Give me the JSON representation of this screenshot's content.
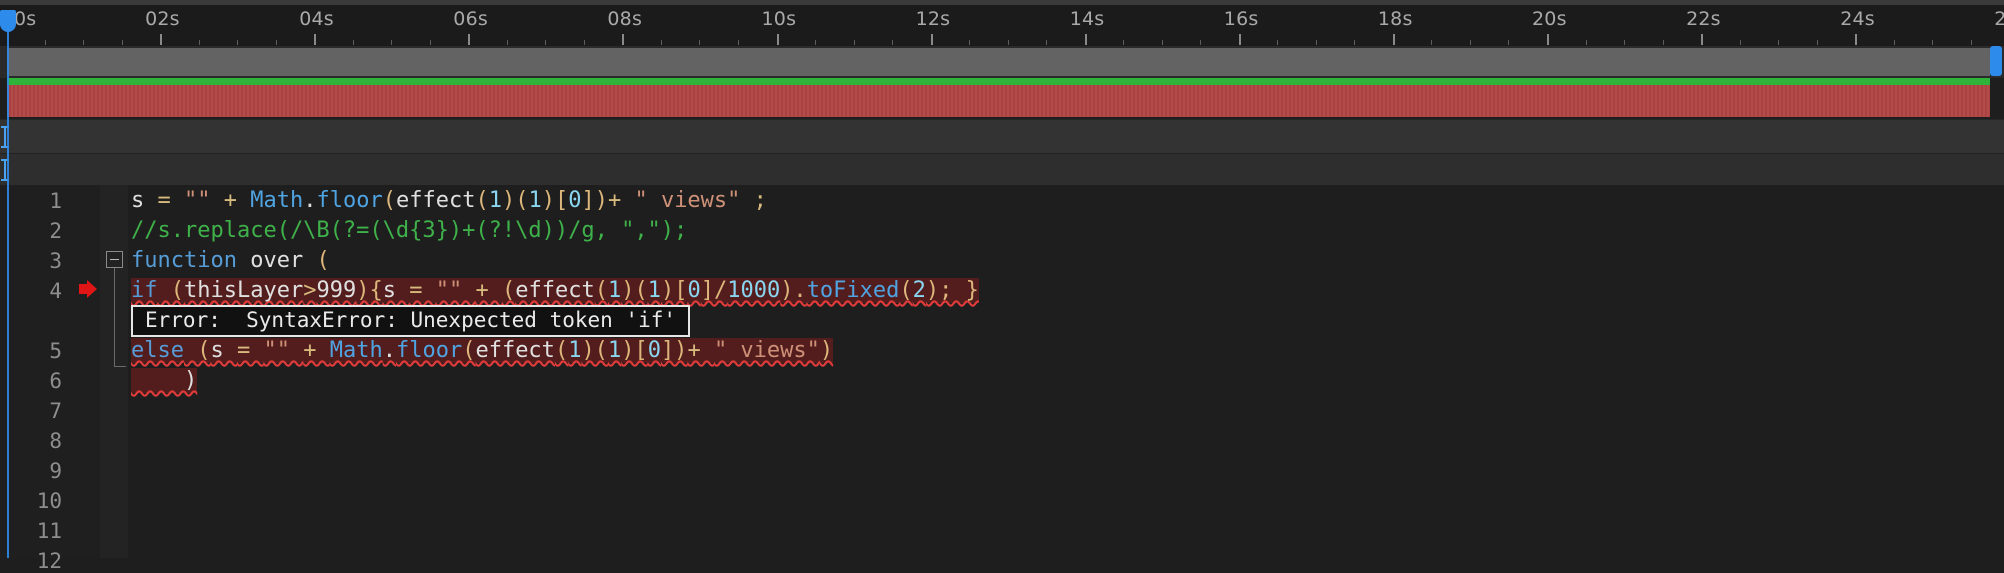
{
  "timeline": {
    "ticks": [
      "0s",
      "02s",
      "04s",
      "06s",
      "08s",
      "10s",
      "12s",
      "14s",
      "16s",
      "18s",
      "20s",
      "22s",
      "24s",
      "2"
    ],
    "colors": {
      "playhead": "#2d8ceb",
      "layer_bar": "#636363",
      "green_bar": "#2fb33a",
      "red_bar": "#b24545"
    }
  },
  "editor": {
    "line_numbers": [
      "1",
      "2",
      "3",
      "4",
      "5",
      "6",
      "7",
      "8",
      "9",
      "10",
      "11",
      "12"
    ],
    "lines": [
      {
        "tokens": [
          {
            "t": "s ",
            "c": "pln"
          },
          {
            "t": "= ",
            "c": "op"
          },
          {
            "t": "\"\" ",
            "c": "str"
          },
          {
            "t": "+ ",
            "c": "op"
          },
          {
            "t": "Math",
            "c": "fn"
          },
          {
            "t": ".",
            "c": "pln"
          },
          {
            "t": "floor",
            "c": "fn"
          },
          {
            "t": "(",
            "c": "paren"
          },
          {
            "t": "effect",
            "c": "pln"
          },
          {
            "t": "(",
            "c": "paren"
          },
          {
            "t": "1",
            "c": "num"
          },
          {
            "t": ")(",
            "c": "paren"
          },
          {
            "t": "1",
            "c": "num"
          },
          {
            "t": ")[",
            "c": "paren"
          },
          {
            "t": "0",
            "c": "num"
          },
          {
            "t": "])",
            "c": "paren"
          },
          {
            "t": "+ ",
            "c": "op"
          },
          {
            "t": "\" views\" ",
            "c": "str"
          },
          {
            "t": ";",
            "c": "op"
          }
        ]
      },
      {
        "tokens": [
          {
            "t": "//s.replace(/\\B(?=(\\d{3})+(?!\\d))/g, \",\");",
            "c": "cmt"
          }
        ]
      },
      {
        "tokens": [
          {
            "t": "function",
            "c": "kw"
          },
          {
            "t": " over ",
            "c": "pln"
          },
          {
            "t": "(",
            "c": "paren"
          }
        ]
      },
      {
        "error": true,
        "tokens": [
          {
            "t": "if",
            "c": "kw"
          },
          {
            "t": " (",
            "c": "paren"
          },
          {
            "t": "thisLayer",
            "c": "pln"
          },
          {
            "t": ">",
            "c": "op"
          },
          {
            "t": "999",
            "c": "pln"
          },
          {
            "t": "){",
            "c": "paren"
          },
          {
            "t": "s ",
            "c": "pln"
          },
          {
            "t": "= ",
            "c": "op"
          },
          {
            "t": "\"\" ",
            "c": "str"
          },
          {
            "t": "+ ",
            "c": "op"
          },
          {
            "t": "(",
            "c": "paren"
          },
          {
            "t": "effect",
            "c": "pln"
          },
          {
            "t": "(",
            "c": "paren"
          },
          {
            "t": "1",
            "c": "num"
          },
          {
            "t": ")(",
            "c": "paren"
          },
          {
            "t": "1",
            "c": "num"
          },
          {
            "t": ")[",
            "c": "paren"
          },
          {
            "t": "0",
            "c": "num"
          },
          {
            "t": "]/",
            "c": "paren"
          },
          {
            "t": "1000",
            "c": "num"
          },
          {
            "t": ").",
            "c": "paren"
          },
          {
            "t": "toFixed",
            "c": "fn"
          },
          {
            "t": "(",
            "c": "paren"
          },
          {
            "t": "2",
            "c": "num"
          },
          {
            "t": "); }",
            "c": "paren"
          }
        ]
      },
      {
        "error": true,
        "tokens": [
          {
            "t": "else",
            "c": "kw"
          },
          {
            "t": " (",
            "c": "paren"
          },
          {
            "t": "s ",
            "c": "pln"
          },
          {
            "t": "= ",
            "c": "op"
          },
          {
            "t": "\"\" ",
            "c": "str"
          },
          {
            "t": "+ ",
            "c": "op"
          },
          {
            "t": "Math",
            "c": "fn"
          },
          {
            "t": ".",
            "c": "pln"
          },
          {
            "t": "floor",
            "c": "fn"
          },
          {
            "t": "(",
            "c": "paren"
          },
          {
            "t": "effect",
            "c": "pln"
          },
          {
            "t": "(",
            "c": "paren"
          },
          {
            "t": "1",
            "c": "num"
          },
          {
            "t": ")(",
            "c": "paren"
          },
          {
            "t": "1",
            "c": "num"
          },
          {
            "t": ")[",
            "c": "paren"
          },
          {
            "t": "0",
            "c": "num"
          },
          {
            "t": "])",
            "c": "paren"
          },
          {
            "t": "+ ",
            "c": "op"
          },
          {
            "t": "\" views\"",
            "c": "str"
          },
          {
            "t": ")",
            "c": "paren"
          }
        ]
      },
      {
        "error": true,
        "tokens": [
          {
            "t": "    )",
            "c": "pln"
          }
        ]
      }
    ],
    "error_message": "Error:  SyntaxError: Unexpected token 'if'"
  }
}
